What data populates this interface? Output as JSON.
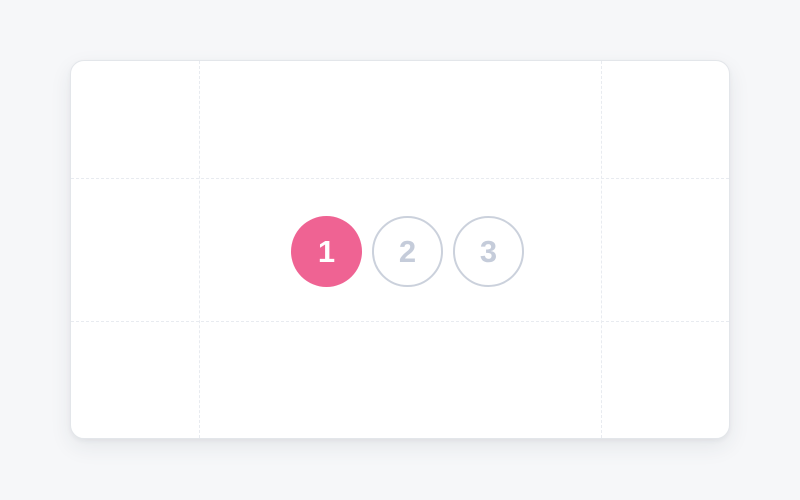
{
  "stepper": {
    "current_step": 1,
    "steps": [
      {
        "label": "1",
        "state": "active"
      },
      {
        "label": "2",
        "state": "inactive"
      },
      {
        "label": "3",
        "state": "inactive"
      }
    ]
  },
  "colors": {
    "page_background": "#f6f7f9",
    "card_background": "#ffffff",
    "active_step": "#ef6393",
    "inactive_step_border": "#cbd1dc",
    "inactive_step_text": "#c5ccda",
    "guide_lines": "#e8ebf0"
  }
}
